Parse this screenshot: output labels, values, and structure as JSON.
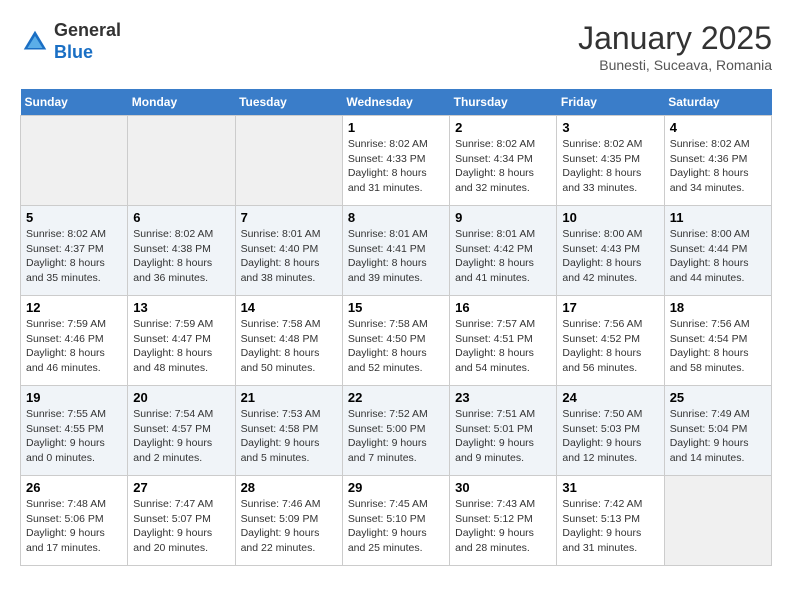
{
  "header": {
    "logo_general": "General",
    "logo_blue": "Blue",
    "month": "January 2025",
    "location": "Bunesti, Suceava, Romania"
  },
  "days_of_week": [
    "Sunday",
    "Monday",
    "Tuesday",
    "Wednesday",
    "Thursday",
    "Friday",
    "Saturday"
  ],
  "weeks": [
    [
      {
        "day": "",
        "info": ""
      },
      {
        "day": "",
        "info": ""
      },
      {
        "day": "",
        "info": ""
      },
      {
        "day": "1",
        "info": "Sunrise: 8:02 AM\nSunset: 4:33 PM\nDaylight: 8 hours and 31 minutes."
      },
      {
        "day": "2",
        "info": "Sunrise: 8:02 AM\nSunset: 4:34 PM\nDaylight: 8 hours and 32 minutes."
      },
      {
        "day": "3",
        "info": "Sunrise: 8:02 AM\nSunset: 4:35 PM\nDaylight: 8 hours and 33 minutes."
      },
      {
        "day": "4",
        "info": "Sunrise: 8:02 AM\nSunset: 4:36 PM\nDaylight: 8 hours and 34 minutes."
      }
    ],
    [
      {
        "day": "5",
        "info": "Sunrise: 8:02 AM\nSunset: 4:37 PM\nDaylight: 8 hours and 35 minutes."
      },
      {
        "day": "6",
        "info": "Sunrise: 8:02 AM\nSunset: 4:38 PM\nDaylight: 8 hours and 36 minutes."
      },
      {
        "day": "7",
        "info": "Sunrise: 8:01 AM\nSunset: 4:40 PM\nDaylight: 8 hours and 38 minutes."
      },
      {
        "day": "8",
        "info": "Sunrise: 8:01 AM\nSunset: 4:41 PM\nDaylight: 8 hours and 39 minutes."
      },
      {
        "day": "9",
        "info": "Sunrise: 8:01 AM\nSunset: 4:42 PM\nDaylight: 8 hours and 41 minutes."
      },
      {
        "day": "10",
        "info": "Sunrise: 8:00 AM\nSunset: 4:43 PM\nDaylight: 8 hours and 42 minutes."
      },
      {
        "day": "11",
        "info": "Sunrise: 8:00 AM\nSunset: 4:44 PM\nDaylight: 8 hours and 44 minutes."
      }
    ],
    [
      {
        "day": "12",
        "info": "Sunrise: 7:59 AM\nSunset: 4:46 PM\nDaylight: 8 hours and 46 minutes."
      },
      {
        "day": "13",
        "info": "Sunrise: 7:59 AM\nSunset: 4:47 PM\nDaylight: 8 hours and 48 minutes."
      },
      {
        "day": "14",
        "info": "Sunrise: 7:58 AM\nSunset: 4:48 PM\nDaylight: 8 hours and 50 minutes."
      },
      {
        "day": "15",
        "info": "Sunrise: 7:58 AM\nSunset: 4:50 PM\nDaylight: 8 hours and 52 minutes."
      },
      {
        "day": "16",
        "info": "Sunrise: 7:57 AM\nSunset: 4:51 PM\nDaylight: 8 hours and 54 minutes."
      },
      {
        "day": "17",
        "info": "Sunrise: 7:56 AM\nSunset: 4:52 PM\nDaylight: 8 hours and 56 minutes."
      },
      {
        "day": "18",
        "info": "Sunrise: 7:56 AM\nSunset: 4:54 PM\nDaylight: 8 hours and 58 minutes."
      }
    ],
    [
      {
        "day": "19",
        "info": "Sunrise: 7:55 AM\nSunset: 4:55 PM\nDaylight: 9 hours and 0 minutes."
      },
      {
        "day": "20",
        "info": "Sunrise: 7:54 AM\nSunset: 4:57 PM\nDaylight: 9 hours and 2 minutes."
      },
      {
        "day": "21",
        "info": "Sunrise: 7:53 AM\nSunset: 4:58 PM\nDaylight: 9 hours and 5 minutes."
      },
      {
        "day": "22",
        "info": "Sunrise: 7:52 AM\nSunset: 5:00 PM\nDaylight: 9 hours and 7 minutes."
      },
      {
        "day": "23",
        "info": "Sunrise: 7:51 AM\nSunset: 5:01 PM\nDaylight: 9 hours and 9 minutes."
      },
      {
        "day": "24",
        "info": "Sunrise: 7:50 AM\nSunset: 5:03 PM\nDaylight: 9 hours and 12 minutes."
      },
      {
        "day": "25",
        "info": "Sunrise: 7:49 AM\nSunset: 5:04 PM\nDaylight: 9 hours and 14 minutes."
      }
    ],
    [
      {
        "day": "26",
        "info": "Sunrise: 7:48 AM\nSunset: 5:06 PM\nDaylight: 9 hours and 17 minutes."
      },
      {
        "day": "27",
        "info": "Sunrise: 7:47 AM\nSunset: 5:07 PM\nDaylight: 9 hours and 20 minutes."
      },
      {
        "day": "28",
        "info": "Sunrise: 7:46 AM\nSunset: 5:09 PM\nDaylight: 9 hours and 22 minutes."
      },
      {
        "day": "29",
        "info": "Sunrise: 7:45 AM\nSunset: 5:10 PM\nDaylight: 9 hours and 25 minutes."
      },
      {
        "day": "30",
        "info": "Sunrise: 7:43 AM\nSunset: 5:12 PM\nDaylight: 9 hours and 28 minutes."
      },
      {
        "day": "31",
        "info": "Sunrise: 7:42 AM\nSunset: 5:13 PM\nDaylight: 9 hours and 31 minutes."
      },
      {
        "day": "",
        "info": ""
      }
    ]
  ]
}
